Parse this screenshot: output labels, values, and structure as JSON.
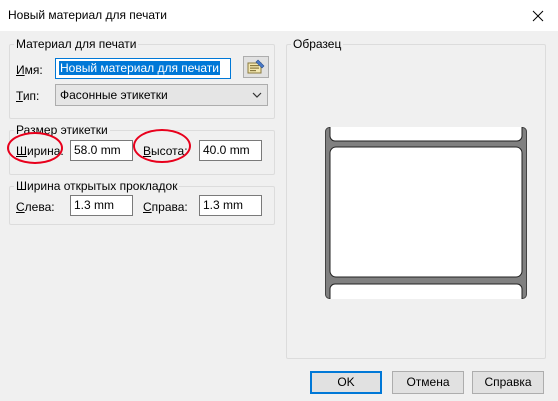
{
  "window": {
    "title": "Новый материал для печати"
  },
  "material": {
    "legend": "Материал для печати",
    "name_label_underlined": "И",
    "name_label_rest": "мя:",
    "name_value": "Новый материал для печати",
    "type_label_underlined": "Т",
    "type_label_rest": "ип:",
    "type_value": "Фасонные этикетки"
  },
  "label_size": {
    "legend": "Размер этикетки",
    "width_label_underlined": "Ш",
    "width_label_rest": "ирина:",
    "width_value": "58.0 mm",
    "height_label_underlined": "В",
    "height_label_rest": "ысота:",
    "height_value": "40.0 mm"
  },
  "liner": {
    "legend": "Ширина открытых прокладок",
    "left_label_underlined": "С",
    "left_label_rest": "лева:",
    "left_value": "1.3 mm",
    "right_label_underlined": "С",
    "right_label_rest": "права:",
    "right_value": "1.3 mm"
  },
  "preview": {
    "legend": "Образец"
  },
  "buttons": {
    "ok": "OK",
    "cancel": "Отмена",
    "help": "Справка"
  },
  "icons": {
    "close": "close-icon",
    "browse": "browse-material-icon",
    "dropdown": "chevron-down-icon"
  },
  "colors": {
    "accent": "#0078d7",
    "annotation": "#e8001c",
    "dialog_bg": "#f0f0f0"
  }
}
